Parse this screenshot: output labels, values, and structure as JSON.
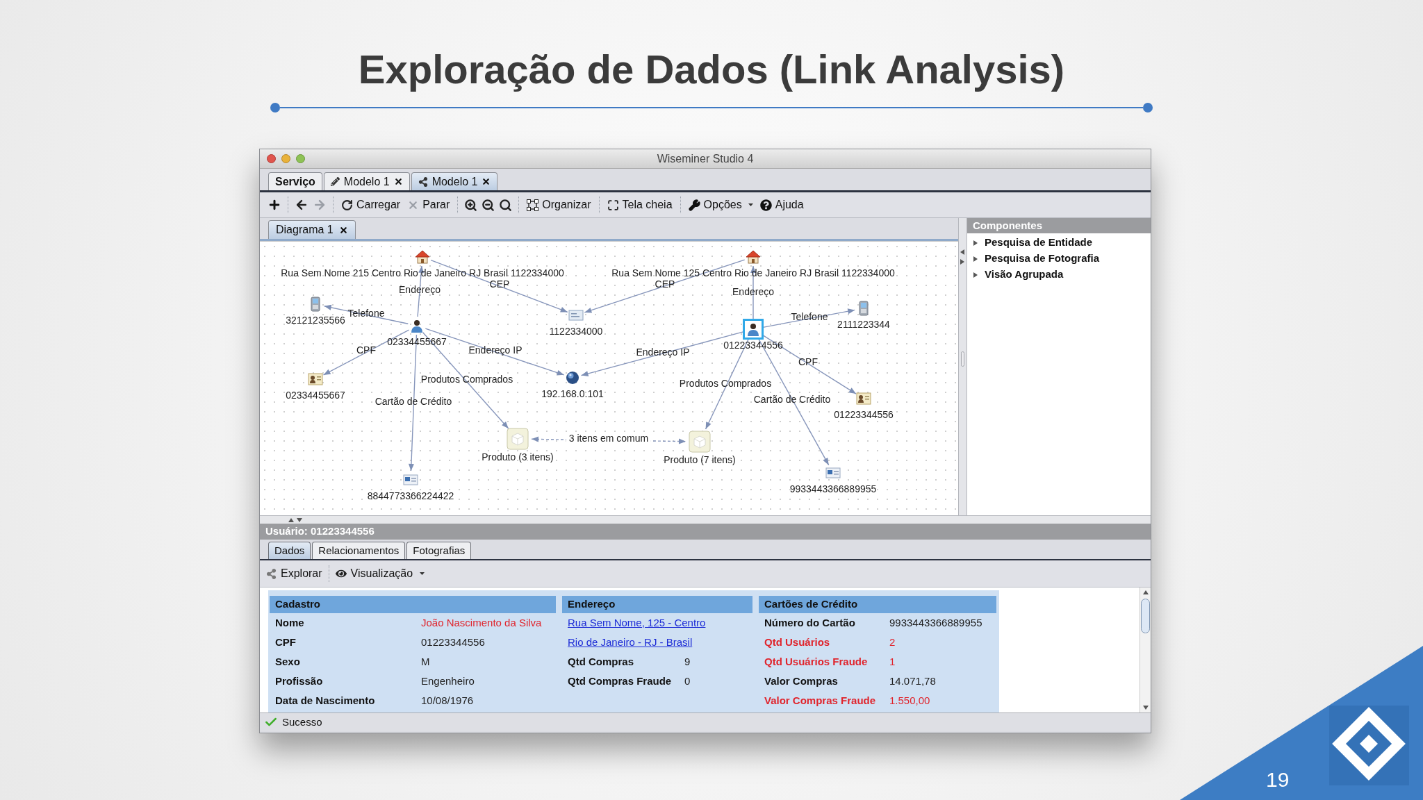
{
  "slide": {
    "title": "Exploração de Dados (Link Analysis)",
    "page_number": "19"
  },
  "window": {
    "title": "Wiseminer Studio 4"
  },
  "tabs": [
    {
      "label": "Serviço",
      "selected": false,
      "closable": false
    },
    {
      "label": "Modelo 1",
      "selected": false,
      "closable": true
    },
    {
      "label": "Modelo 1",
      "selected": true,
      "closable": true
    }
  ],
  "toolbar": [
    {
      "label": "Carregar",
      "dropdown": false
    },
    {
      "label": "Parar",
      "dropdown": false
    },
    {
      "label": "Organizar",
      "dropdown": false
    },
    {
      "label": "Tela cheia",
      "dropdown": false
    },
    {
      "label": "Opções",
      "dropdown": true
    },
    {
      "label": "Ajuda",
      "dropdown": false
    }
  ],
  "diagram_tabs": [
    {
      "label": "Diagrama 1",
      "selected": true
    }
  ],
  "graph": {
    "nodes": [
      {
        "kind": "house",
        "label": "Rua Sem Nome 215 Centro Rio de Janeiro RJ Brasil 1122334000",
        "selected": false
      },
      {
        "kind": "phone",
        "label": "32121235566",
        "selected": false
      },
      {
        "kind": "person",
        "label": "02334455667",
        "selected": false
      },
      {
        "kind": "id_card",
        "label": "02334455667",
        "selected": false
      },
      {
        "kind": "postal_code",
        "label": "1122334000",
        "selected": false
      },
      {
        "kind": "ip",
        "label": "192.168.0.101",
        "selected": false
      },
      {
        "kind": "product",
        "label": "Produto (3 itens)",
        "selected": false
      },
      {
        "kind": "credit_card",
        "label": "8844773366224422",
        "selected": false
      },
      {
        "kind": "house",
        "label": "Rua Sem Nome 125 Centro Rio de Janeiro RJ Brasil 1122334000",
        "selected": false
      },
      {
        "kind": "person",
        "label": "01223344556",
        "selected": true
      },
      {
        "kind": "phone",
        "label": "2111223344",
        "selected": false
      },
      {
        "kind": "id_card",
        "label": "01223344556",
        "selected": false
      },
      {
        "kind": "product",
        "label": "Produto (7 itens)",
        "selected": false
      },
      {
        "kind": "credit_card",
        "label": "9933443366889955",
        "selected": false
      }
    ],
    "edges": [
      {
        "kind": "relation",
        "label": "Endereço"
      },
      {
        "kind": "relation",
        "label": "CEP"
      },
      {
        "kind": "relation",
        "label": "Telefone"
      },
      {
        "kind": "relation",
        "label": "CPF"
      },
      {
        "kind": "relation",
        "label": "Endereço IP"
      },
      {
        "kind": "relation",
        "label": "Produtos Comprados"
      },
      {
        "kind": "relation",
        "label": "Cartão de Crédito"
      },
      {
        "kind": "relation",
        "label": "CEP"
      },
      {
        "kind": "relation",
        "label": "Endereço"
      },
      {
        "kind": "relation",
        "label": "Telefone"
      },
      {
        "kind": "relation",
        "label": "Endereço IP"
      },
      {
        "kind": "relation",
        "label": "CPF"
      },
      {
        "kind": "relation",
        "label": "Produtos Comprados"
      },
      {
        "kind": "relation",
        "label": "Cartão de Crédito"
      },
      {
        "kind": "shared",
        "label": "3 itens em comum"
      }
    ]
  },
  "components_panel": {
    "title": "Componentes",
    "items": [
      {
        "label": "Pesquisa de Entidade",
        "expanded": false
      },
      {
        "label": "Pesquisa de Fotografia",
        "expanded": false
      },
      {
        "label": "Visão Agrupada",
        "expanded": false
      }
    ]
  },
  "details": {
    "title": "Usuário: 01223344556",
    "tabs": [
      {
        "label": "Dados",
        "selected": true
      },
      {
        "label": "Relacionamentos",
        "selected": false
      },
      {
        "label": "Fotografias",
        "selected": false
      }
    ],
    "toolbar": [
      {
        "label": "Explorar",
        "dropdown": false
      },
      {
        "label": "Visualização",
        "dropdown": true
      }
    ],
    "sections": [
      {
        "title": "Cadastro",
        "rows": [
          {
            "kind": "field",
            "label": "Nome",
            "value": "João Nascimento da Silva",
            "label_alert": false,
            "value_alert": true
          },
          {
            "kind": "field",
            "label": "CPF",
            "value": "01223344556",
            "label_alert": false,
            "value_alert": false
          },
          {
            "kind": "field",
            "label": "Sexo",
            "value": "M",
            "label_alert": false,
            "value_alert": false
          },
          {
            "kind": "field",
            "label": "Profissão",
            "value": "Engenheiro",
            "label_alert": false,
            "value_alert": false
          },
          {
            "kind": "field",
            "label": "Data de Nascimento",
            "value": "10/08/1976",
            "label_alert": false,
            "value_alert": false
          }
        ]
      },
      {
        "title": "Endereço",
        "rows": [
          {
            "kind": "link",
            "value": "Rua Sem Nome, 125 - Centro"
          },
          {
            "kind": "link",
            "value": "Rio de Janeiro - RJ - Brasil"
          },
          {
            "kind": "field",
            "label": "Qtd Compras",
            "value": "9",
            "label_alert": false,
            "value_alert": false
          },
          {
            "kind": "field",
            "label": "Qtd Compras Fraude",
            "value": "0",
            "label_alert": false,
            "value_alert": false
          }
        ]
      },
      {
        "title": "Cartões de Crédito",
        "rows": [
          {
            "kind": "field",
            "label": "Número do Cartão",
            "value": "9933443366889955",
            "label_alert": false,
            "value_alert": false
          },
          {
            "kind": "field",
            "label": "Qtd Usuários",
            "value": "2",
            "label_alert": true,
            "value_alert": true
          },
          {
            "kind": "field",
            "label": "Qtd Usuários Fraude",
            "value": "1",
            "label_alert": true,
            "value_alert": true
          },
          {
            "kind": "field",
            "label": "Valor Compras",
            "value": "14.071,78",
            "label_alert": false,
            "value_alert": false
          },
          {
            "kind": "field",
            "label": "Valor Compras Fraude",
            "value": "1.550,00",
            "label_alert": true,
            "value_alert": true
          }
        ]
      }
    ]
  },
  "status_bar": {
    "message": "Sucesso"
  }
}
